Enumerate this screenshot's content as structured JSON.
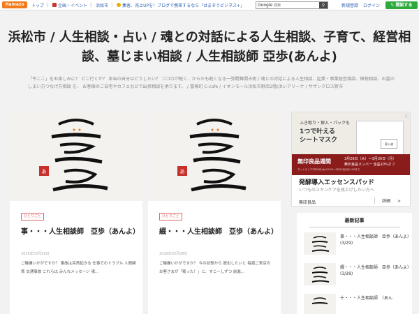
{
  "topbar": {
    "logo": "Hamazo",
    "nav": [
      {
        "label": "トップ"
      },
      {
        "label": "企画・イベント"
      },
      {
        "label": "浜松市"
      }
    ],
    "promo": "集客、売上UPを！ブログで携帯するなら「はまぞうビジネス+」",
    "search_label": "Google",
    "search_placeholder": "検索",
    "register": "新規登録",
    "login": "ログイン",
    "start": "開設する"
  },
  "site": {
    "title": "浜松市 / 人生相談・占い / 魂との対話による人生相談、子育て、経営相談、墓じまい相談 / 人生相談師 亞歩(あんよ)",
    "description": "「今ここ」をお楽しみに？ どこ行くか？ 本当の自分はどうしたい？ ココロが軽く、からだも軽くなる一弥開舞間占術 / 魂との対話による人生相談、起業・事業経営相談、徴税相談、お墓のしまい方つなげ方相談 を、 お客様のご自宅やカフェなどで出張相談を承ります。 / 富塚町 C-cafe / イオンモール浜松市野店2階/浜いアリーナ / サザンクロス新市"
  },
  "cards": [
    {
      "tag": "ひとりごと",
      "title": "事・・・人生相談師　亞歩（あんよ）",
      "date": "2026年03月29日",
      "excerpt": "ご機嫌いかがですか？ 事故は突然起きる 仕事でのトラブル 人間関係 交通事故 これらは みんなメッセージ 魂..."
    },
    {
      "tag": "ひとりごと",
      "title": "綴・・・人生相談師　亞歩（あんよ）",
      "date": "2026年03月28日",
      "excerpt": "ご機嫌いかがですか？ 今の状態から 脱出したいと 毎週ご来店の お客さまが「叛った！」と、すこ～しずつ 前進..."
    }
  ],
  "ad": {
    "headline_line1": "ふき取り・保入・パックも",
    "headline_line2": "1つで叶える",
    "headline_line3": "シートマスク",
    "product_label": "導入液",
    "sale_title": "無印良品週間",
    "sale_dates": "3月26日（木）〜3月30日（月）",
    "sale_member": "無印良品メンバー 全品10%オフ",
    "sale_note": "ネットストア3月26日(木)10:00〜3月30日(月)9:59まで",
    "product_name": "発酵導入エッセンスパッド",
    "product_sub": "いつものスキンケアを底上げしたい方へ",
    "brand": "無印良品",
    "detail": "詳細",
    "detail_arrow": ">"
  },
  "recent": {
    "heading": "最新記事",
    "items": [
      {
        "title": "事・・・人生相談師　亞歩（あんよ）",
        "date": "(3/29)"
      },
      {
        "title": "綴・・・人生相談師　亞歩（あんよ）",
        "date": "(3/28)"
      },
      {
        "title": "十・・・人生相談師　（あん",
        "date": ""
      }
    ]
  }
}
